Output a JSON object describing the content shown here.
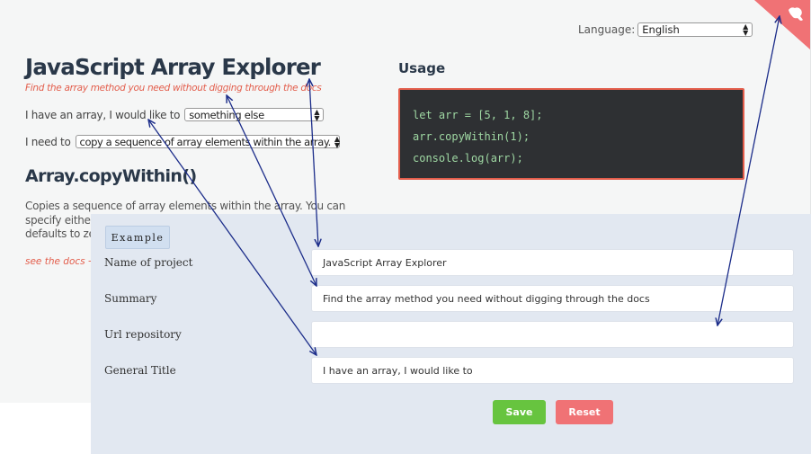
{
  "app": {
    "language_label": "Language:",
    "language_value": "English",
    "title": "JavaScript Array Explorer",
    "subtitle": "Find the array method you need without digging through the docs",
    "row1_label": "I have an array, I would like to",
    "row1_value": "something else",
    "row2_label": "I need to",
    "row2_value": "copy a sequence of array elements within the array.",
    "method_title": "Array.copyWithin()",
    "description": "Copies a sequence of array elements within the array. You can specify either just the ending element (where the beginning defaults to zero) or both the beginning and the ending.",
    "docs_link": "see the docs →",
    "usage_title": "Usage",
    "code": [
      "let arr = [5, 1, 8];",
      "arr.copyWithin(1);",
      "console.log(arr);"
    ]
  },
  "form": {
    "tab": "Example",
    "fields": [
      {
        "label": "Name of project",
        "value": "JavaScript Array Explorer"
      },
      {
        "label": "Summary",
        "value": "Find the array method you need without digging through the docs"
      },
      {
        "label": "Url repository",
        "value": ""
      },
      {
        "label": "General Title",
        "value": "I have an array, I would like to"
      }
    ],
    "save_label": "Save",
    "reset_label": "Reset"
  },
  "colors": {
    "accent_red": "#e35d4b",
    "save_green": "#67c43f",
    "reset_red": "#f07275",
    "code_bg": "#2e3033",
    "arrow": "#1c2d8a"
  }
}
